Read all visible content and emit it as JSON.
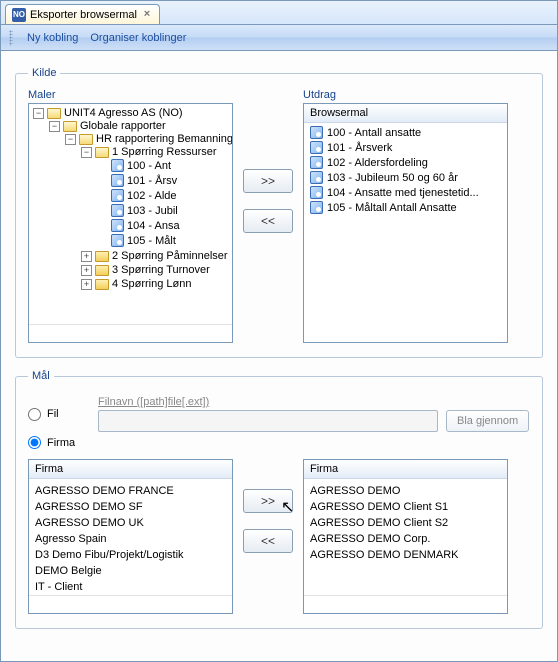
{
  "tab": {
    "icon_text": "NO",
    "title": "Eksporter browsermal"
  },
  "toolbar": {
    "new_link": "Ny kobling",
    "organize": "Organiser koblinger"
  },
  "kilde": {
    "legend": "Kilde",
    "maler_label": "Maler",
    "utdrag_label": "Utdrag",
    "root": "UNIT4 Agresso AS (NO)",
    "global_reports": "Globale rapporter",
    "hr_reporting": "HR rapportering Bemanning",
    "query1": "1 Spørring Ressurser",
    "reports": [
      "100 - Antall ansatte",
      "101 - Årsverk",
      "102 - Aldersfordeling",
      "103 - Jubileum 50 og 60 år",
      "104 - Ansatte med tjenestetid...",
      "105 - Måltall Antall Ansatte"
    ],
    "tree_reports_short": [
      "100 - Ant",
      "101 - Årsv",
      "102 - Alde",
      "103 - Jubil",
      "104 - Ansa",
      "105 - Målt"
    ],
    "query2": "2 Spørring Påminnelser",
    "query3": "3 Spørring Turnover",
    "query4": "4 Spørring Lønn",
    "utdrag_header": "Browsermal",
    "btn_add": ">>",
    "btn_remove": "<<"
  },
  "mal": {
    "legend": "Mål",
    "fil_label": "Fil",
    "firma_label": "Firma",
    "filnavn_label": "Filnavn ([path]file[.ext])",
    "browse": "Bla gjennom",
    "firma_header": "Firma",
    "left_firmas": [
      "AGRESSO DEMO FRANCE",
      "AGRESSO DEMO SF",
      "AGRESSO DEMO UK",
      "Agresso Spain",
      "D3 Demo Fibu/Projekt/Logistik",
      "DEMO Belgie",
      "IT - Client"
    ],
    "right_firmas": [
      "AGRESSO DEMO",
      "AGRESSO DEMO Client S1",
      "AGRESSO DEMO Client S2",
      "AGRESSO DEMO Corp.",
      "AGRESSO DEMO DENMARK"
    ],
    "btn_add": ">>",
    "btn_remove": "<<"
  }
}
